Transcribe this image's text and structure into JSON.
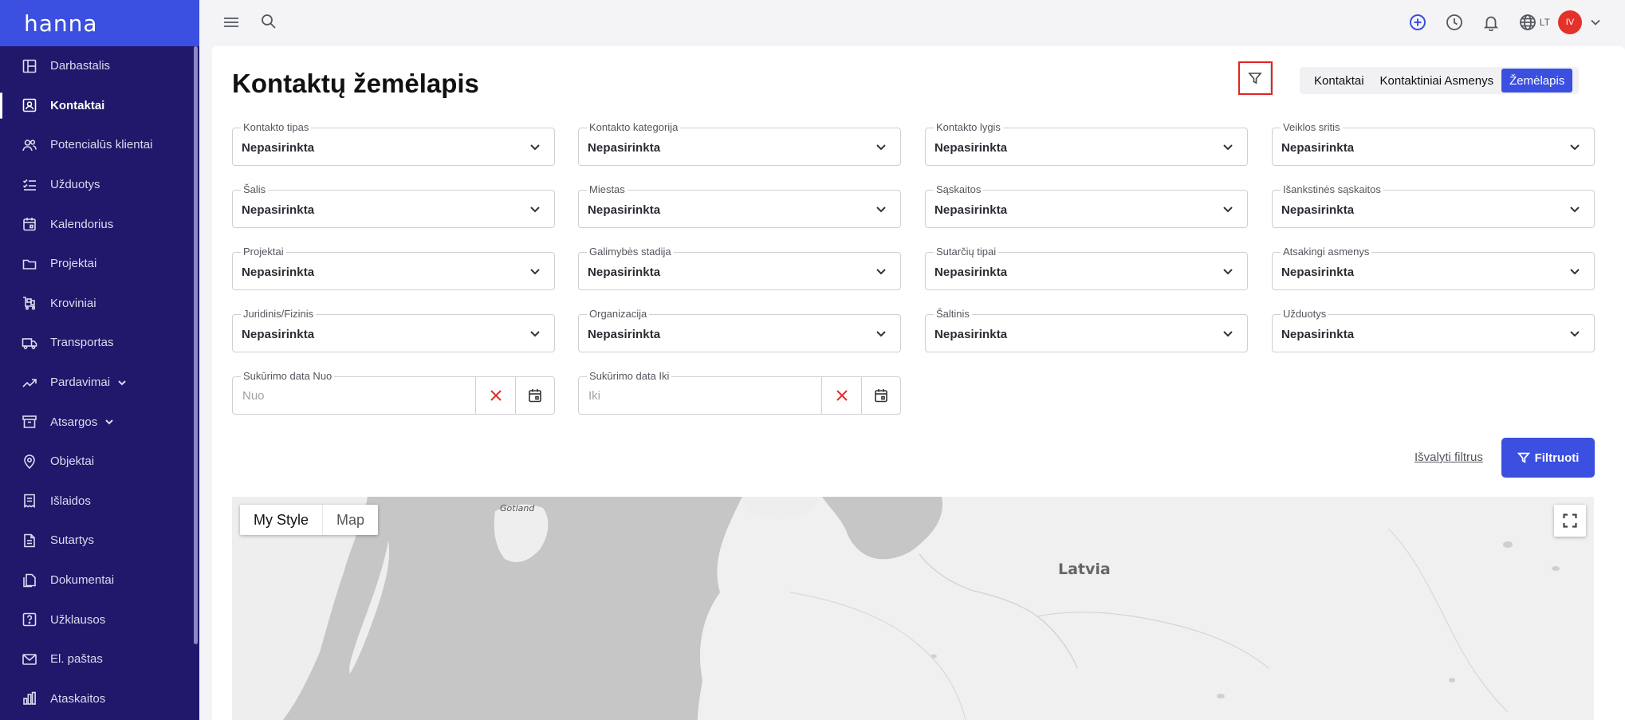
{
  "brand": {
    "logo": "hanna"
  },
  "sidebar": {
    "items": [
      {
        "label": "Darbastalis",
        "icon": "dashboard-icon"
      },
      {
        "label": "Kontaktai",
        "icon": "contacts-icon",
        "active": true
      },
      {
        "label": "Potencialūs klientai",
        "icon": "users-icon"
      },
      {
        "label": "Užduotys",
        "icon": "tasks-icon"
      },
      {
        "label": "Kalendorius",
        "icon": "calendar-icon"
      },
      {
        "label": "Projektai",
        "icon": "folder-icon"
      },
      {
        "label": "Kroviniai",
        "icon": "cart-icon"
      },
      {
        "label": "Transportas",
        "icon": "truck-icon"
      },
      {
        "label": "Pardavimai",
        "icon": "trend-icon",
        "expandable": true
      },
      {
        "label": "Atsargos",
        "icon": "archive-icon",
        "expandable": true
      },
      {
        "label": "Objektai",
        "icon": "pin-icon"
      },
      {
        "label": "Išlaidos",
        "icon": "expenses-icon"
      },
      {
        "label": "Sutartys",
        "icon": "document-icon"
      },
      {
        "label": "Dokumentai",
        "icon": "documents-icon"
      },
      {
        "label": "Užklausos",
        "icon": "question-icon"
      },
      {
        "label": "El. paštas",
        "icon": "mail-icon"
      },
      {
        "label": "Ataskaitos",
        "icon": "reports-icon"
      }
    ]
  },
  "topbar": {
    "language": "LT",
    "user_initials": "IV"
  },
  "page": {
    "title": "Kontaktų žemėlapis",
    "views": [
      {
        "label": "Kontaktai",
        "active": false
      },
      {
        "label": "Kontaktiniai Asmenys",
        "active": false
      },
      {
        "label": "Žemėlapis",
        "active": true
      }
    ]
  },
  "filters": {
    "default_value": "Nepasirinkta",
    "fields": [
      {
        "label": "Kontakto tipas",
        "value": "Nepasirinkta"
      },
      {
        "label": "Kontakto kategorija",
        "value": "Nepasirinkta"
      },
      {
        "label": "Kontakto lygis",
        "value": "Nepasirinkta"
      },
      {
        "label": "Veiklos sritis",
        "value": "Nepasirinkta"
      },
      {
        "label": "Šalis",
        "value": "Nepasirinkta"
      },
      {
        "label": "Miestas",
        "value": "Nepasirinkta"
      },
      {
        "label": "Sąskaitos",
        "value": "Nepasirinkta"
      },
      {
        "label": "Išankstinės sąskaitos",
        "value": "Nepasirinkta"
      },
      {
        "label": "Projektai",
        "value": "Nepasirinkta"
      },
      {
        "label": "Galimybės stadija",
        "value": "Nepasirinkta"
      },
      {
        "label": "Sutarčių tipai",
        "value": "Nepasirinkta"
      },
      {
        "label": "Atsakingi asmenys",
        "value": "Nepasirinkta"
      },
      {
        "label": "Juridinis/Fizinis",
        "value": "Nepasirinkta"
      },
      {
        "label": "Organizacija",
        "value": "Nepasirinkta"
      },
      {
        "label": "Šaltinis",
        "value": "Nepasirinkta"
      },
      {
        "label": "Užduotys",
        "value": "Nepasirinkta"
      }
    ],
    "date_from": {
      "label": "Sukūrimo data Nuo",
      "placeholder": "Nuo",
      "value": ""
    },
    "date_to": {
      "label": "Sukūrimo data Iki",
      "placeholder": "Iki",
      "value": ""
    },
    "clear_label": "Išvalyti filtrus",
    "apply_label": "Filtruoti"
  },
  "map": {
    "types": [
      {
        "label": "My Style",
        "active": true
      },
      {
        "label": "Map",
        "active": false
      }
    ],
    "labels": {
      "gotland": "Gotland",
      "latvia": "Latvia"
    }
  },
  "colors": {
    "brand": "#3b4fe0",
    "sidebar": "#20186a",
    "danger": "#e0312a"
  }
}
